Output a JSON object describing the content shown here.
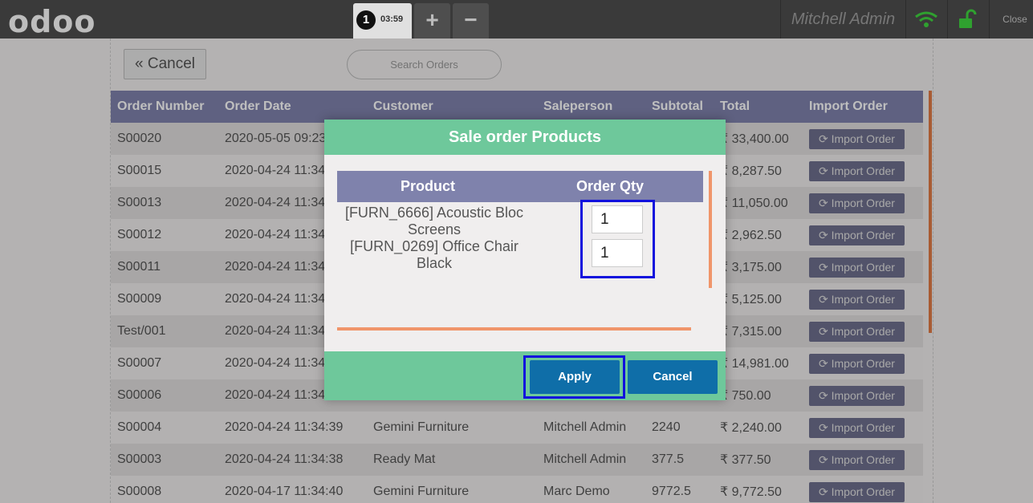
{
  "topbar": {
    "logo": "odoo",
    "order_tab": {
      "badge": "1",
      "time": "03:59"
    },
    "add_order_label": "+",
    "remove_order_label": "−",
    "user": "Mitchell Admin",
    "close_label": "Close",
    "wifi_icon": "wifi-icon",
    "lock_icon": "lock-icon",
    "status_color": "#2fa12f"
  },
  "screen": {
    "cancel_label": "« Cancel",
    "search_placeholder": "Search Orders"
  },
  "orders_table": {
    "headers": [
      "Order Number",
      "Order Date",
      "Customer",
      "Saleperson",
      "Subtotal",
      "Total",
      "Import Order"
    ],
    "import_label": "⟳ Import Order",
    "rows": [
      {
        "number": "S00020",
        "date": "2020-05-05 09:23",
        "customer": "",
        "saleperson": "",
        "subtotal": "",
        "total": "₹ 33,400.00"
      },
      {
        "number": "S00015",
        "date": "2020-04-24 11:34",
        "customer": "",
        "saleperson": "",
        "subtotal": "",
        "total": "₹ 8,287.50"
      },
      {
        "number": "S00013",
        "date": "2020-04-24 11:34",
        "customer": "",
        "saleperson": "",
        "subtotal": "",
        "total": "₹ 11,050.00"
      },
      {
        "number": "S00012",
        "date": "2020-04-24 11:34",
        "customer": "",
        "saleperson": "",
        "subtotal": "",
        "total": "₹ 2,962.50"
      },
      {
        "number": "S00011",
        "date": "2020-04-24 11:34",
        "customer": "",
        "saleperson": "",
        "subtotal": "",
        "total": "₹ 3,175.00"
      },
      {
        "number": "S00009",
        "date": "2020-04-24 11:34",
        "customer": "",
        "saleperson": "",
        "subtotal": "",
        "total": "₹ 5,125.00"
      },
      {
        "number": "Test/001",
        "date": "2020-04-24 11:34",
        "customer": "",
        "saleperson": "",
        "subtotal": "",
        "total": "₹ 7,315.00"
      },
      {
        "number": "S00007",
        "date": "2020-04-24 11:34",
        "customer": "",
        "saleperson": "",
        "subtotal": "",
        "total": "₹ 14,981.00"
      },
      {
        "number": "S00006",
        "date": "2020-04-24 11:34",
        "customer": "",
        "saleperson": "",
        "subtotal": "",
        "total": "₹ 750.00"
      },
      {
        "number": "S00004",
        "date": "2020-04-24 11:34:39",
        "customer": "Gemini Furniture",
        "saleperson": "Mitchell Admin",
        "subtotal": "2240",
        "total": "₹ 2,240.00"
      },
      {
        "number": "S00003",
        "date": "2020-04-24 11:34:38",
        "customer": "Ready Mat",
        "saleperson": "Mitchell Admin",
        "subtotal": "377.5",
        "total": "₹ 377.50"
      },
      {
        "number": "S00008",
        "date": "2020-04-17 11:34:40",
        "customer": "Gemini Furniture",
        "saleperson": "Marc Demo",
        "subtotal": "9772.5",
        "total": "₹ 9,772.50"
      }
    ]
  },
  "modal": {
    "title": "Sale order Products",
    "col_product": "Product",
    "col_qty": "Order Qty",
    "products": [
      {
        "line1": "[FURN_6666] Acoustic Bloc",
        "line2": "Screens",
        "qty": "1"
      },
      {
        "line1": "[FURN_0269] Office Chair",
        "line2": "Black",
        "qty": "1"
      }
    ],
    "apply_label": "Apply",
    "cancel_label": "Cancel"
  }
}
